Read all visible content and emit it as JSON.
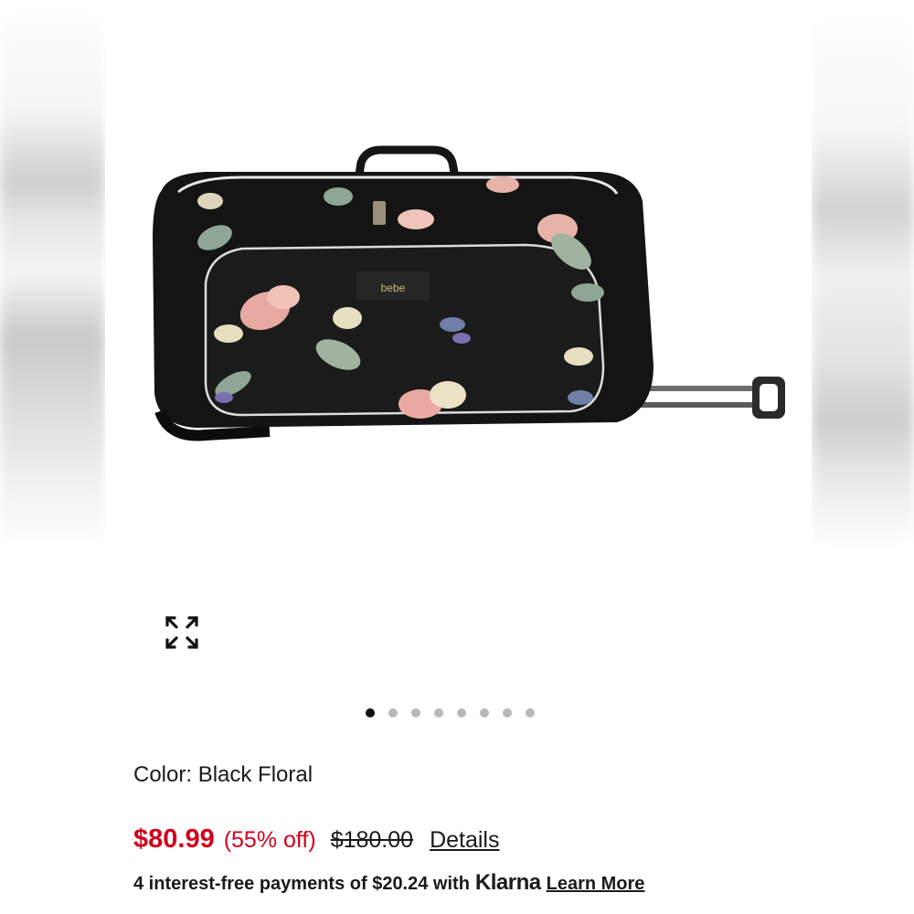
{
  "product": {
    "image_brand_tag": "bebe",
    "image_alt": "Black Floral rolling duffel bag"
  },
  "gallery": {
    "dot_count": 8,
    "active_index": 0
  },
  "color": {
    "label": "Color: Black Floral"
  },
  "price": {
    "sale": "$80.99",
    "discount": "(55% off)",
    "original": "$180.00",
    "details_label": "Details"
  },
  "financing": {
    "text": "4 interest-free payments of $20.24 with",
    "brand": "Klarna",
    "learn_more_label": "Learn More"
  },
  "colors": {
    "sale": "#d0021b",
    "text": "#1a1a1a",
    "dot_active": "#111111",
    "dot_inactive": "#b8b8b8"
  },
  "icons": {
    "expand": "expand-arrows-icon"
  }
}
